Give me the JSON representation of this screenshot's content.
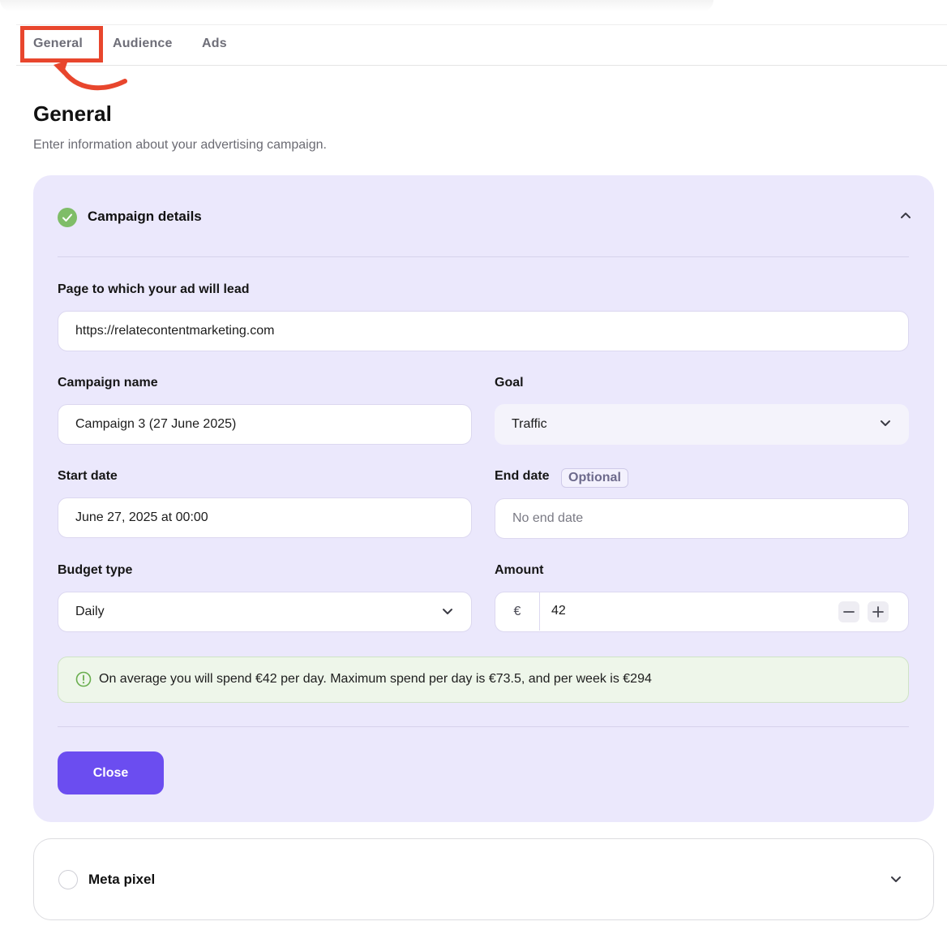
{
  "tabs": [
    {
      "label": "General"
    },
    {
      "label": "Audience"
    },
    {
      "label": "Ads"
    }
  ],
  "page": {
    "title": "General",
    "subtitle": "Enter information about your advertising campaign."
  },
  "campaign_details": {
    "title": "Campaign details",
    "status_icon": "check-circle-icon",
    "page_label": "Page to which your ad will lead",
    "page_value": "https://relatecontentmarketing.com",
    "name_label": "Campaign name",
    "name_value": "Campaign 3 (27 June 2025)",
    "goal_label": "Goal",
    "goal_value": "Traffic",
    "start_label": "Start date",
    "start_value": "June 27, 2025 at 00:00",
    "end_label": "End date",
    "end_badge": "Optional",
    "end_placeholder": "No end date",
    "budget_type_label": "Budget type",
    "budget_type_value": "Daily",
    "amount_label": "Amount",
    "currency_symbol": "€",
    "amount_value": "42",
    "info_text": "On average you will spend €42 per day. Maximum spend per day is €73.5, and per week is €294",
    "close_label": "Close"
  },
  "meta_pixel": {
    "title": "Meta pixel"
  },
  "colors": {
    "accent": "#6b4df0",
    "card_bg": "#ebe8fc",
    "success": "#7fbd68",
    "annotation": "#e8462d"
  }
}
